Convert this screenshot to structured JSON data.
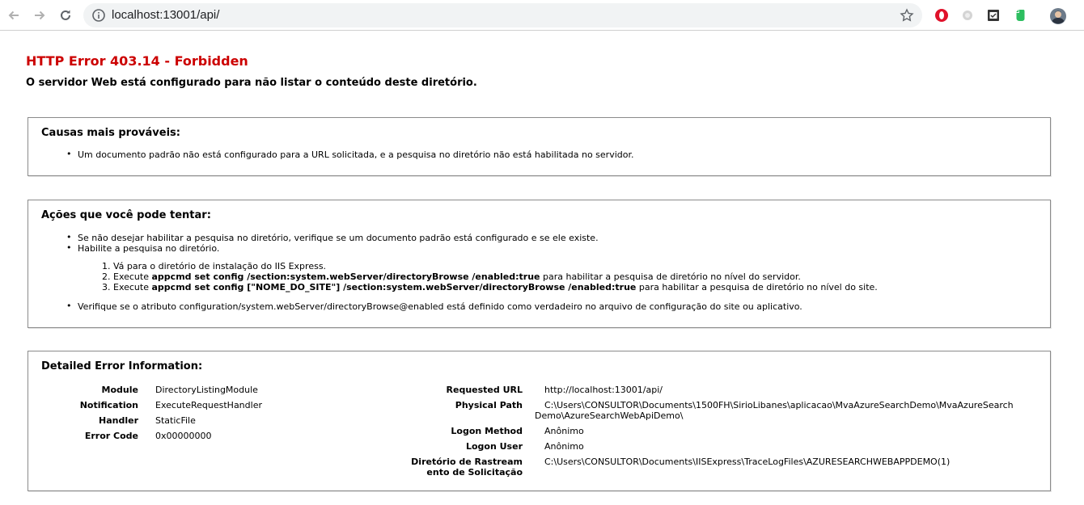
{
  "browser": {
    "url": "localhost:13001/api/",
    "icons": [
      "back-icon",
      "forward-icon",
      "reload-icon",
      "info-icon",
      "star-icon",
      "opera-extension-icon",
      "circle-extension-icon",
      "grammar-extension-icon",
      "evernote-extension-icon",
      "avatar"
    ]
  },
  "error": {
    "title": "HTTP Error 403.14 - Forbidden",
    "subtitle": "O servidor Web está configurado para não listar o conteúdo deste diretório."
  },
  "causes": {
    "heading": "Causas mais prováveis:",
    "items": [
      "Um documento padrão não está configurado para a URL solicitada, e a pesquisa no diretório não está habilitada no servidor."
    ]
  },
  "actions": {
    "heading": "Ações que você pode tentar:",
    "bullet1": "Se não desejar habilitar a pesquisa no diretório, verifique se um documento padrão está configurado e se ele existe.",
    "bullet2": "Habilite a pesquisa no diretório.",
    "steps": [
      {
        "num": "1.",
        "pre": "Vá para o diretório de instalação do IIS Express.",
        "code": "",
        "post": ""
      },
      {
        "num": "2.",
        "pre": "Execute ",
        "code": "appcmd set config /section:system.webServer/directoryBrowse /enabled:true",
        "post": " para habilitar a pesquisa de diretório no nível do servidor."
      },
      {
        "num": "3.",
        "pre": "Execute ",
        "code": "appcmd set config [\"NOME_DO_SITE\"] /section:system.webServer/directoryBrowse /enabled:true",
        "post": " para habilitar a pesquisa de diretório no nível do site."
      }
    ],
    "bullet3": "Verifique se o atributo configuration/system.webServer/directoryBrowse@enabled está definido como verdadeiro no arquivo de configuração do site ou aplicativo."
  },
  "details": {
    "heading": "Detailed Error Information:",
    "left": [
      {
        "label": "Module",
        "value": "DirectoryListingModule"
      },
      {
        "label": "Notification",
        "value": "ExecuteRequestHandler"
      },
      {
        "label": "Handler",
        "value": "StaticFile"
      },
      {
        "label": "Error Code",
        "value": "0x00000000"
      }
    ],
    "right": {
      "requested_url_label": "Requested URL",
      "requested_url": "http://localhost:13001/api/",
      "physical_path_label": "Physical Path",
      "physical_path_line1": "C:\\Users\\CONSULTOR\\Documents\\1500FH\\SirioLibanes\\aplicacao\\MvaAzureSearchDemo\\MvaAzureSearch",
      "physical_path_line2": "Demo\\AzureSearchWebApiDemo\\",
      "logon_method_label": "Logon Method",
      "logon_method": "Anônimo",
      "logon_user_label": "Logon User",
      "logon_user": "Anônimo",
      "trace_label_line1": "Diretório de Rastream",
      "trace_label_line2": "ento de Solicitação",
      "trace_value": "C:\\Users\\CONSULTOR\\Documents\\IISExpress\\TraceLogFiles\\AZURESEARCHWEBAPPDEMO(1)"
    }
  }
}
